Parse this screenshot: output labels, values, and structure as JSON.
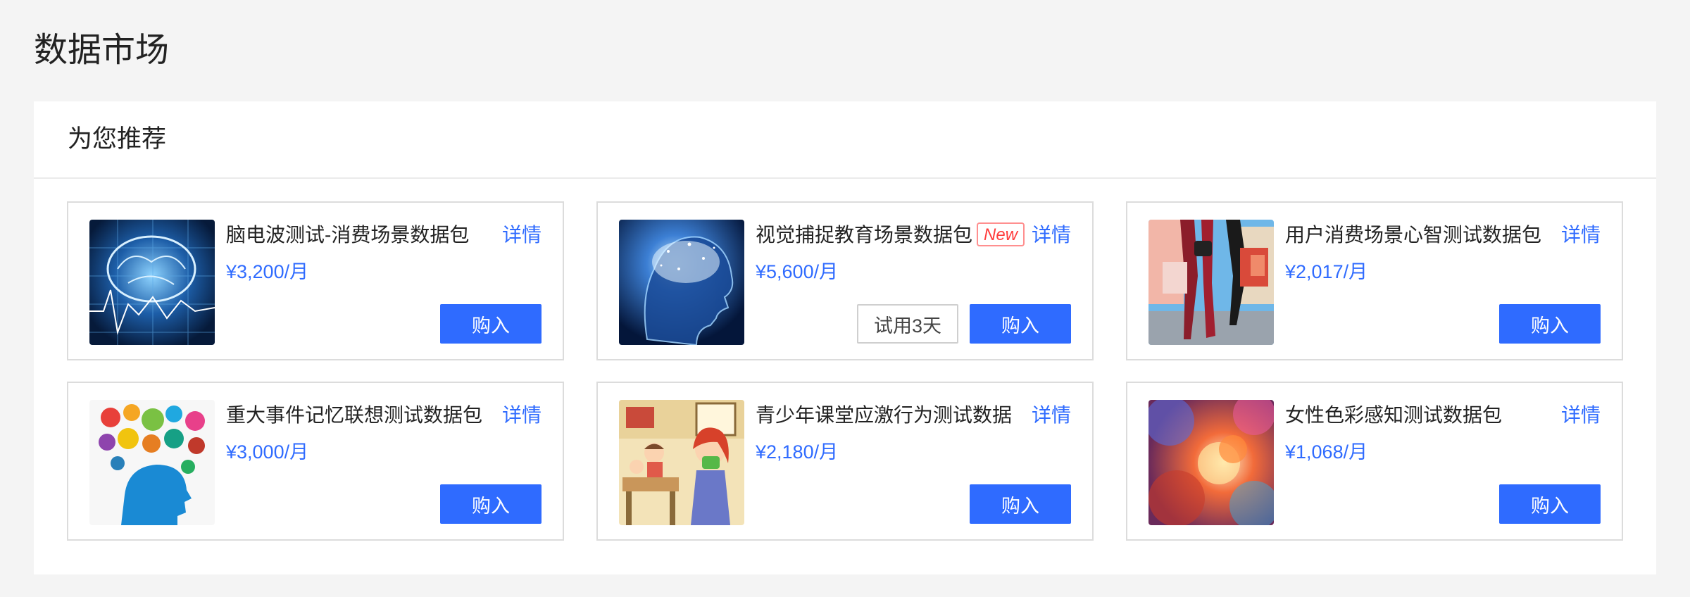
{
  "page": {
    "title": "数据市场"
  },
  "recommend": {
    "title": "为您推荐",
    "detail_label": "详情",
    "buy_label": "购入",
    "trial_label": "试用3天",
    "new_badge": "New",
    "cards": [
      {
        "name": "脑电波测试-消费场景数据包",
        "price": "¥3,200/月",
        "image": "brain-eeg-image"
      },
      {
        "name": "视觉捕捉教育场景数据包",
        "price": "¥5,600/月",
        "image": "glowing-head-image",
        "is_new": true,
        "has_trial": true
      },
      {
        "name": "用户消费场景心智测试数据包",
        "price": "¥2,017/月",
        "image": "shopping-women-image"
      },
      {
        "name": "重大事件记忆联想测试数据包",
        "price": "¥3,000/月",
        "image": "head-ideas-image"
      },
      {
        "name": "青少年课堂应激行为测试数据",
        "price": "¥2,180/月",
        "image": "classroom-cartoon-image"
      },
      {
        "name": "女性色彩感知测试数据包",
        "price": "¥1,068/月",
        "image": "color-smoke-image"
      }
    ]
  },
  "colors": {
    "accent": "#2f6bff",
    "badge": "#ff3c3c",
    "background": "#f4f4f4"
  }
}
